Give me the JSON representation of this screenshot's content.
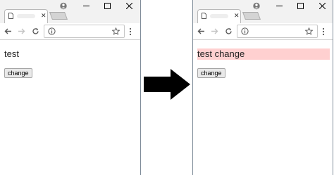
{
  "panels": [
    {
      "content": {
        "text": "test",
        "button_label": "change",
        "text_highlight": ""
      }
    },
    {
      "content": {
        "text": "test change",
        "button_label": "change",
        "text_highlight": "#ffd0d0"
      }
    }
  ],
  "icons": {
    "tab_page": "page-icon",
    "tab_close": "close-icon",
    "profile": "user-icon",
    "back": "arrow-left-icon",
    "forward": "arrow-right-icon",
    "reload": "reload-icon",
    "info": "info-icon",
    "bookmark": "star-icon",
    "menu": "vertical-ellipsis-icon",
    "transition": "right-arrow-icon"
  },
  "colors": {
    "highlight": "#ffd0d0",
    "titlebar": "#f2f2f2",
    "arrow": "#000000"
  }
}
